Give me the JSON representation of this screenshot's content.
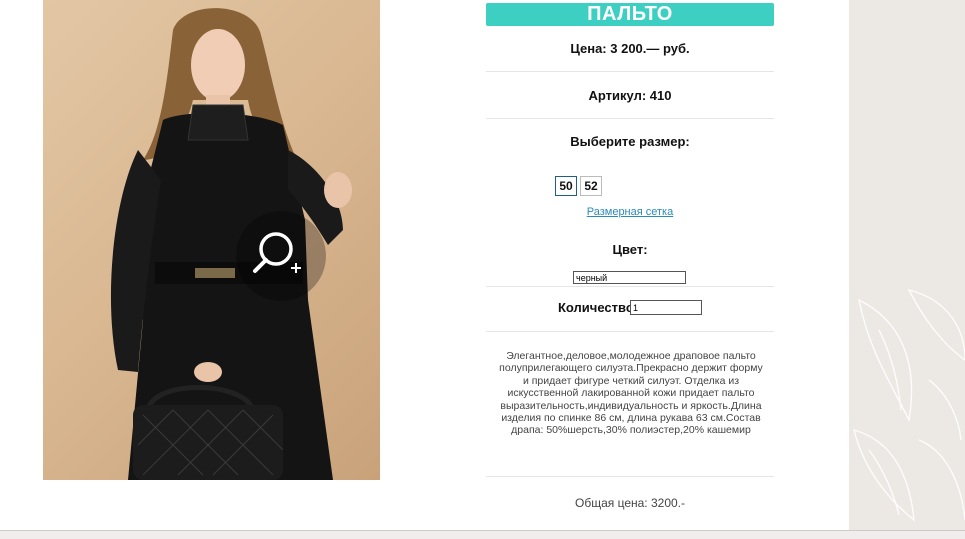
{
  "product": {
    "title": "ПАЛЬТО",
    "price_label": "Цена: 3 200.— руб.",
    "sku_label": "Артикул: 410",
    "size_prompt": "Выберите размер:",
    "sizes": [
      {
        "label": "50",
        "selected": true
      },
      {
        "label": "52",
        "selected": false
      }
    ],
    "size_chart_link": "Размерная сетка",
    "color_label": "Цвет:",
    "color_value": "черный",
    "quantity_label": "Количество:",
    "quantity_value": "1",
    "description": "Элегантное,деловое,молодежное драповое пальто полуприлегающего силуэта.Прекрасно держит форму и придает фигуре четкий силуэт. Отделка из искусственной лакированной кожи придает пальто выразительность,индивидуальность и яркость.Длина изделия по спинке 86 см, длина рукава 63 см.Состав драпа: 50%шерсть,30% полиэстер,20% кашемир",
    "total_label": "Общая цена: 3200.-"
  },
  "colors": {
    "accent": "#3ecfc3",
    "link": "#2a8ab8",
    "side_background": "#ece8e3"
  },
  "icons": {
    "zoom": "magnifier-plus-icon",
    "dropdown": "chevron-down-icon"
  }
}
